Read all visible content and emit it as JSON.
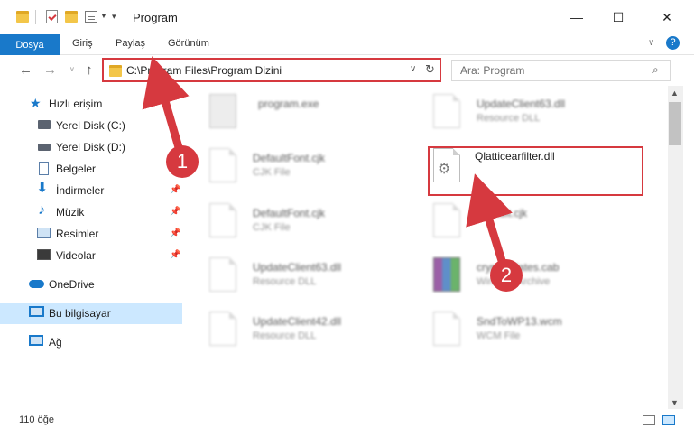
{
  "window": {
    "title": "Program",
    "minimize": "—",
    "maximize": "☐",
    "close": "✕"
  },
  "ribbon": {
    "tabs": [
      "Dosya",
      "Giriş",
      "Paylaş",
      "Görünüm"
    ],
    "help": "?"
  },
  "nav": {
    "address": "C:\\Program Files\\Program Dizini",
    "search_placeholder": "Ara: Program"
  },
  "sidebar": {
    "items": [
      {
        "label": "Hızlı erişim",
        "icon": "star-icon"
      },
      {
        "label": "Yerel Disk (C:)",
        "icon": "drive-icon"
      },
      {
        "label": "Yerel Disk (D:)",
        "icon": "drive-icon"
      },
      {
        "label": "Belgeler",
        "icon": "documents-icon"
      },
      {
        "label": "İndirmeler",
        "icon": "download-icon"
      },
      {
        "label": "Müzik",
        "icon": "music-icon"
      },
      {
        "label": "Resimler",
        "icon": "pictures-icon"
      },
      {
        "label": "Videolar",
        "icon": "videos-icon"
      },
      {
        "label": "OneDrive",
        "icon": "cloud-icon"
      },
      {
        "label": "Bu bilgisayar",
        "icon": "computer-icon"
      },
      {
        "label": "Ağ",
        "icon": "network-icon"
      }
    ]
  },
  "files": [
    {
      "name": "program.exe",
      "type": ""
    },
    {
      "name": "UpdateClient63.dll",
      "type": "Resource DLL"
    },
    {
      "name": "DefaultFont.cjk",
      "type": "CJK File"
    },
    {
      "name": "Qlatticearfilter.dll",
      "type": ""
    },
    {
      "name": "DefaultFont.cjk",
      "type": "CJK File"
    },
    {
      "name": "Default.cjk",
      "type": ""
    },
    {
      "name": "UpdateClient63.dll",
      "type": "Resource DLL"
    },
    {
      "name": "cryptupdates.cab",
      "type": "WinRAR Archive"
    },
    {
      "name": "UpdateClient42.dll",
      "type": "Resource DLL"
    },
    {
      "name": "SndToWP13.wcm",
      "type": "WCM File"
    }
  ],
  "status": {
    "count": "110 öğe"
  },
  "annotations": {
    "step1": "1",
    "step2": "2",
    "color": "#d6393f"
  }
}
